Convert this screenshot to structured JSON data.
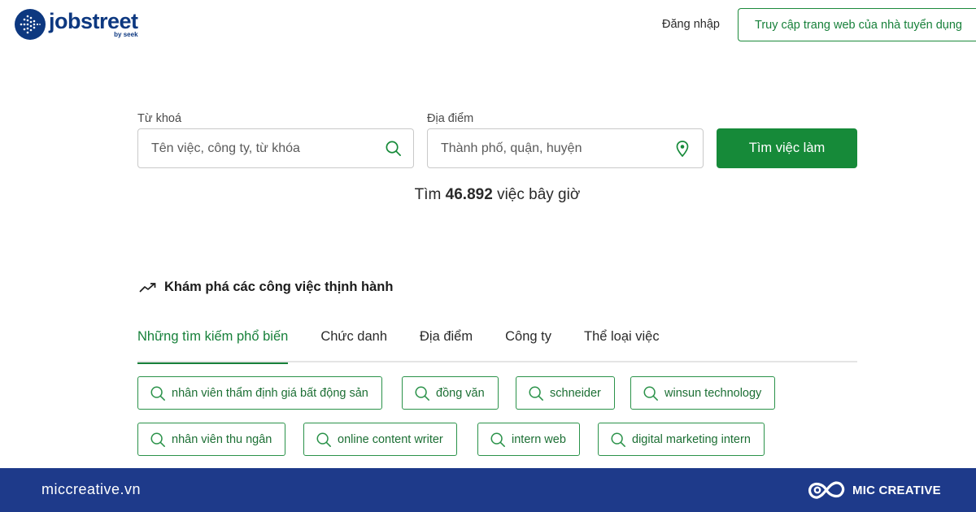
{
  "header": {
    "logo_text": "jobstreet",
    "logo_sub": "by seek",
    "login_label": "Đăng nhập",
    "employer_label": "Truy cập trang web của nhà tuyển dụng"
  },
  "search": {
    "keyword_label": "Từ khoá",
    "keyword_placeholder": "Tên việc, công ty, từ khóa",
    "location_label": "Địa điểm",
    "location_placeholder": "Thành phố, quận, huyện",
    "button_label": "Tìm việc làm"
  },
  "job_count": {
    "prefix": "Tìm",
    "count": "46.892",
    "suffix": "việc bây giờ"
  },
  "trending": {
    "heading": "Khám phá các công việc thịnh hành",
    "tabs": [
      {
        "label": "Những tìm kiếm phổ biến",
        "active": true
      },
      {
        "label": "Chức danh"
      },
      {
        "label": "Địa điểm"
      },
      {
        "label": "Công ty"
      },
      {
        "label": "Thể loại việc"
      }
    ],
    "chips": [
      "nhân viên thẩm định giá bất động sản",
      "đồng văn",
      "schneider",
      "winsun technology",
      "nhân viên thu ngân",
      "online content writer",
      "intern web",
      "digital marketing intern"
    ]
  },
  "footer": {
    "site": "miccreative.vn",
    "brand": "MIC CREATIVE"
  },
  "colors": {
    "brand_blue": "#0d3880",
    "accent_green": "#168a39",
    "footer_blue": "#1e3a8a"
  },
  "icons": {
    "logo": "jobstreet-dot-globe-icon",
    "keyword": "search-icon",
    "location": "map-pin-icon",
    "trending": "trending-up-icon",
    "chip": "search-icon",
    "footer_brand": "mic-infinity-logo-icon"
  }
}
